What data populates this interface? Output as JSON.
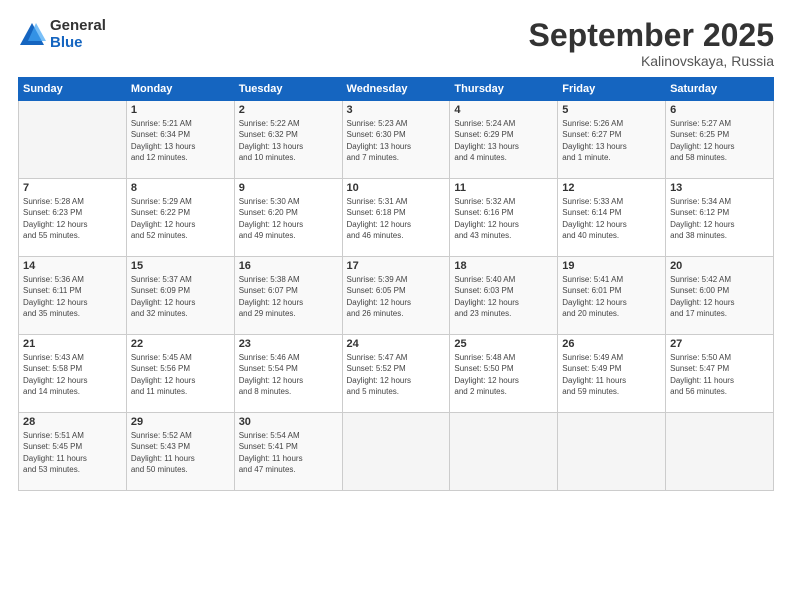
{
  "logo": {
    "general": "General",
    "blue": "Blue"
  },
  "title": "September 2025",
  "location": "Kalinovskaya, Russia",
  "headers": [
    "Sunday",
    "Monday",
    "Tuesday",
    "Wednesday",
    "Thursday",
    "Friday",
    "Saturday"
  ],
  "weeks": [
    [
      {
        "day": "",
        "info": ""
      },
      {
        "day": "1",
        "info": "Sunrise: 5:21 AM\nSunset: 6:34 PM\nDaylight: 13 hours\nand 12 minutes."
      },
      {
        "day": "2",
        "info": "Sunrise: 5:22 AM\nSunset: 6:32 PM\nDaylight: 13 hours\nand 10 minutes."
      },
      {
        "day": "3",
        "info": "Sunrise: 5:23 AM\nSunset: 6:30 PM\nDaylight: 13 hours\nand 7 minutes."
      },
      {
        "day": "4",
        "info": "Sunrise: 5:24 AM\nSunset: 6:29 PM\nDaylight: 13 hours\nand 4 minutes."
      },
      {
        "day": "5",
        "info": "Sunrise: 5:26 AM\nSunset: 6:27 PM\nDaylight: 13 hours\nand 1 minute."
      },
      {
        "day": "6",
        "info": "Sunrise: 5:27 AM\nSunset: 6:25 PM\nDaylight: 12 hours\nand 58 minutes."
      }
    ],
    [
      {
        "day": "7",
        "info": "Sunrise: 5:28 AM\nSunset: 6:23 PM\nDaylight: 12 hours\nand 55 minutes."
      },
      {
        "day": "8",
        "info": "Sunrise: 5:29 AM\nSunset: 6:22 PM\nDaylight: 12 hours\nand 52 minutes."
      },
      {
        "day": "9",
        "info": "Sunrise: 5:30 AM\nSunset: 6:20 PM\nDaylight: 12 hours\nand 49 minutes."
      },
      {
        "day": "10",
        "info": "Sunrise: 5:31 AM\nSunset: 6:18 PM\nDaylight: 12 hours\nand 46 minutes."
      },
      {
        "day": "11",
        "info": "Sunrise: 5:32 AM\nSunset: 6:16 PM\nDaylight: 12 hours\nand 43 minutes."
      },
      {
        "day": "12",
        "info": "Sunrise: 5:33 AM\nSunset: 6:14 PM\nDaylight: 12 hours\nand 40 minutes."
      },
      {
        "day": "13",
        "info": "Sunrise: 5:34 AM\nSunset: 6:12 PM\nDaylight: 12 hours\nand 38 minutes."
      }
    ],
    [
      {
        "day": "14",
        "info": "Sunrise: 5:36 AM\nSunset: 6:11 PM\nDaylight: 12 hours\nand 35 minutes."
      },
      {
        "day": "15",
        "info": "Sunrise: 5:37 AM\nSunset: 6:09 PM\nDaylight: 12 hours\nand 32 minutes."
      },
      {
        "day": "16",
        "info": "Sunrise: 5:38 AM\nSunset: 6:07 PM\nDaylight: 12 hours\nand 29 minutes."
      },
      {
        "day": "17",
        "info": "Sunrise: 5:39 AM\nSunset: 6:05 PM\nDaylight: 12 hours\nand 26 minutes."
      },
      {
        "day": "18",
        "info": "Sunrise: 5:40 AM\nSunset: 6:03 PM\nDaylight: 12 hours\nand 23 minutes."
      },
      {
        "day": "19",
        "info": "Sunrise: 5:41 AM\nSunset: 6:01 PM\nDaylight: 12 hours\nand 20 minutes."
      },
      {
        "day": "20",
        "info": "Sunrise: 5:42 AM\nSunset: 6:00 PM\nDaylight: 12 hours\nand 17 minutes."
      }
    ],
    [
      {
        "day": "21",
        "info": "Sunrise: 5:43 AM\nSunset: 5:58 PM\nDaylight: 12 hours\nand 14 minutes."
      },
      {
        "day": "22",
        "info": "Sunrise: 5:45 AM\nSunset: 5:56 PM\nDaylight: 12 hours\nand 11 minutes."
      },
      {
        "day": "23",
        "info": "Sunrise: 5:46 AM\nSunset: 5:54 PM\nDaylight: 12 hours\nand 8 minutes."
      },
      {
        "day": "24",
        "info": "Sunrise: 5:47 AM\nSunset: 5:52 PM\nDaylight: 12 hours\nand 5 minutes."
      },
      {
        "day": "25",
        "info": "Sunrise: 5:48 AM\nSunset: 5:50 PM\nDaylight: 12 hours\nand 2 minutes."
      },
      {
        "day": "26",
        "info": "Sunrise: 5:49 AM\nSunset: 5:49 PM\nDaylight: 11 hours\nand 59 minutes."
      },
      {
        "day": "27",
        "info": "Sunrise: 5:50 AM\nSunset: 5:47 PM\nDaylight: 11 hours\nand 56 minutes."
      }
    ],
    [
      {
        "day": "28",
        "info": "Sunrise: 5:51 AM\nSunset: 5:45 PM\nDaylight: 11 hours\nand 53 minutes."
      },
      {
        "day": "29",
        "info": "Sunrise: 5:52 AM\nSunset: 5:43 PM\nDaylight: 11 hours\nand 50 minutes."
      },
      {
        "day": "30",
        "info": "Sunrise: 5:54 AM\nSunset: 5:41 PM\nDaylight: 11 hours\nand 47 minutes."
      },
      {
        "day": "",
        "info": ""
      },
      {
        "day": "",
        "info": ""
      },
      {
        "day": "",
        "info": ""
      },
      {
        "day": "",
        "info": ""
      }
    ]
  ]
}
